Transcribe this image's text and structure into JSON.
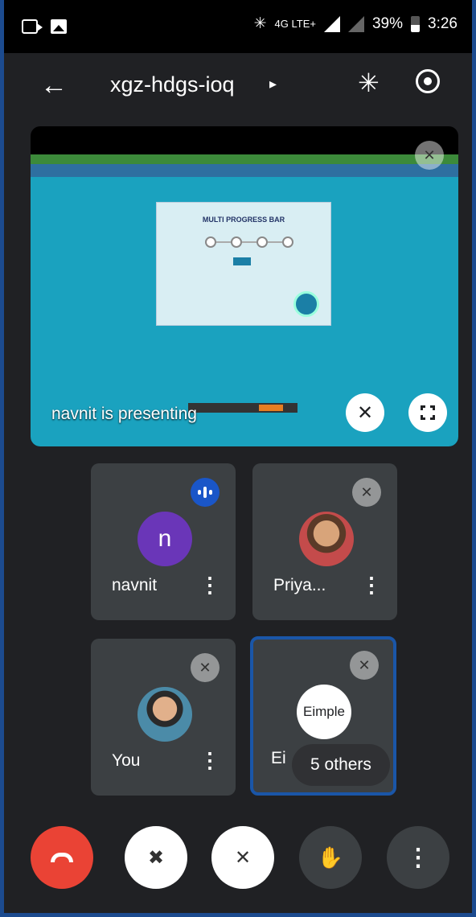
{
  "status_bar": {
    "network": "4G LTE+",
    "battery": "39%",
    "time": "3:26"
  },
  "top_bar": {
    "meeting_code": "xgz-hdgs-ioq"
  },
  "presentation": {
    "slide_title": "MULTI PROGRESS BAR",
    "presenting_label": "navnit is presenting"
  },
  "participants": [
    {
      "name": "navnit",
      "avatar_letter": "n",
      "state": "speaking"
    },
    {
      "name": "Priya...",
      "state": "muted"
    },
    {
      "name": "You",
      "state": "muted"
    },
    {
      "name": "Ei",
      "avatar_text": "Eimple",
      "state": "muted"
    }
  ],
  "others_pill": "5 others",
  "icons": {
    "end_call": "phone-hangup-icon",
    "camera": "camera-off-icon",
    "mic": "mic-off-icon",
    "hand": "raise-hand-icon",
    "more": "more-vert-icon"
  },
  "colors": {
    "end_call": "#ea4335",
    "active_border": "#1a56a8",
    "speaking_badge": "#1a56c8"
  }
}
